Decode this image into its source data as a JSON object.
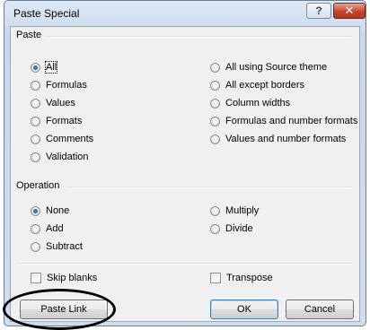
{
  "dialog": {
    "title": "Paste Special",
    "help_glyph": "?",
    "close_glyph": "✕"
  },
  "paste": {
    "label": "Paste",
    "left_options": [
      {
        "label": "All",
        "selected": true
      },
      {
        "label": "Formulas",
        "selected": false
      },
      {
        "label": "Values",
        "selected": false
      },
      {
        "label": "Formats",
        "selected": false
      },
      {
        "label": "Comments",
        "selected": false
      },
      {
        "label": "Validation",
        "selected": false
      }
    ],
    "right_options": [
      {
        "label": "All using Source theme",
        "selected": false
      },
      {
        "label": "All except borders",
        "selected": false
      },
      {
        "label": "Column widths",
        "selected": false
      },
      {
        "label": "Formulas and number formats",
        "selected": false
      },
      {
        "label": "Values and number formats",
        "selected": false
      }
    ]
  },
  "operation": {
    "label": "Operation",
    "left_options": [
      {
        "label": "None",
        "selected": true
      },
      {
        "label": "Add",
        "selected": false
      },
      {
        "label": "Subtract",
        "selected": false
      }
    ],
    "right_options": [
      {
        "label": "Multiply",
        "selected": false
      },
      {
        "label": "Divide",
        "selected": false
      }
    ]
  },
  "checkboxes": {
    "skip_blanks": {
      "label": "Skip blanks",
      "checked": false
    },
    "transpose": {
      "label": "Transpose",
      "checked": false
    }
  },
  "buttons": {
    "paste_link": "Paste Link",
    "ok": "OK",
    "cancel": "Cancel"
  },
  "colors": {
    "selected_radio": "#1f5fb4",
    "close_button": "#c8452f",
    "highlight_ellipse": "#000000"
  }
}
